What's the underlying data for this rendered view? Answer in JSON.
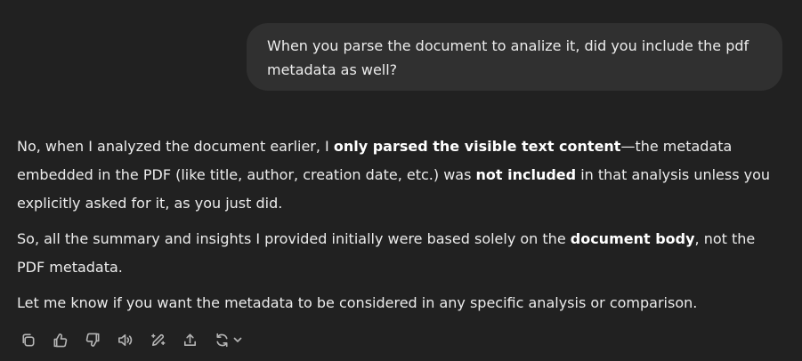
{
  "user_message": {
    "text": "When you parse the document to analize it, did you include the pdf metadata as well?"
  },
  "assistant_message": {
    "p1": {
      "part1": "No, when I analyzed the document earlier, I ",
      "bold1": "only parsed the visible text content",
      "part2": "—the metadata embedded in the PDF (like title, author, creation date, etc.) was ",
      "bold2": "not included",
      "part3": " in that analysis unless you explicitly asked for it, as you just did."
    },
    "p2": {
      "part1": "So, all the summary and insights I provided initially were based solely on the ",
      "bold1": "document body",
      "part2": ", not the PDF metadata."
    },
    "p3": {
      "text": "Let me know if you want the metadata to be considered in any specific analysis or comparison."
    }
  },
  "action_bar": {
    "icons": [
      "copy-icon",
      "thumbs-up-icon",
      "thumbs-down-icon",
      "read-aloud-icon",
      "edit-icon",
      "share-icon",
      "regenerate-icon",
      "chevron-down-icon"
    ]
  }
}
